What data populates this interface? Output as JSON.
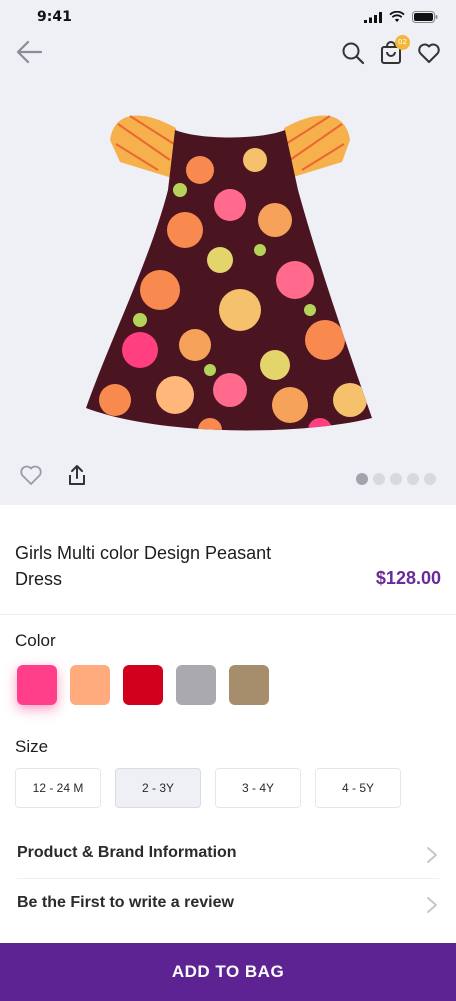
{
  "status_bar": {
    "time": "9:41"
  },
  "header": {
    "cart_count": "02"
  },
  "product": {
    "title": "Girls Multi color Design Peasant Dress",
    "price": "$128.00",
    "image_alt": "girls-peasant-dress-photo"
  },
  "gallery": {
    "total_images": 5,
    "active_index": 0
  },
  "color": {
    "label": "Color",
    "swatches": [
      "#ff3f8a",
      "#ffab7e",
      "#d1001c",
      "#a9a9ae",
      "#a68d6b"
    ],
    "selected_index": 0
  },
  "size": {
    "label": "Size",
    "options": [
      "12 - 24 M",
      "2 - 3Y",
      "3 - 4Y",
      "4 - 5Y"
    ],
    "selected_index": 1
  },
  "info_rows": [
    {
      "label": "Product & Brand Information"
    },
    {
      "label": "Be the First to write a review"
    }
  ],
  "cta": {
    "label": "ADD TO BAG"
  },
  "colors": {
    "accent": "#5e2392",
    "price": "#6a2a98",
    "hero_bg": "#eef0f6"
  }
}
